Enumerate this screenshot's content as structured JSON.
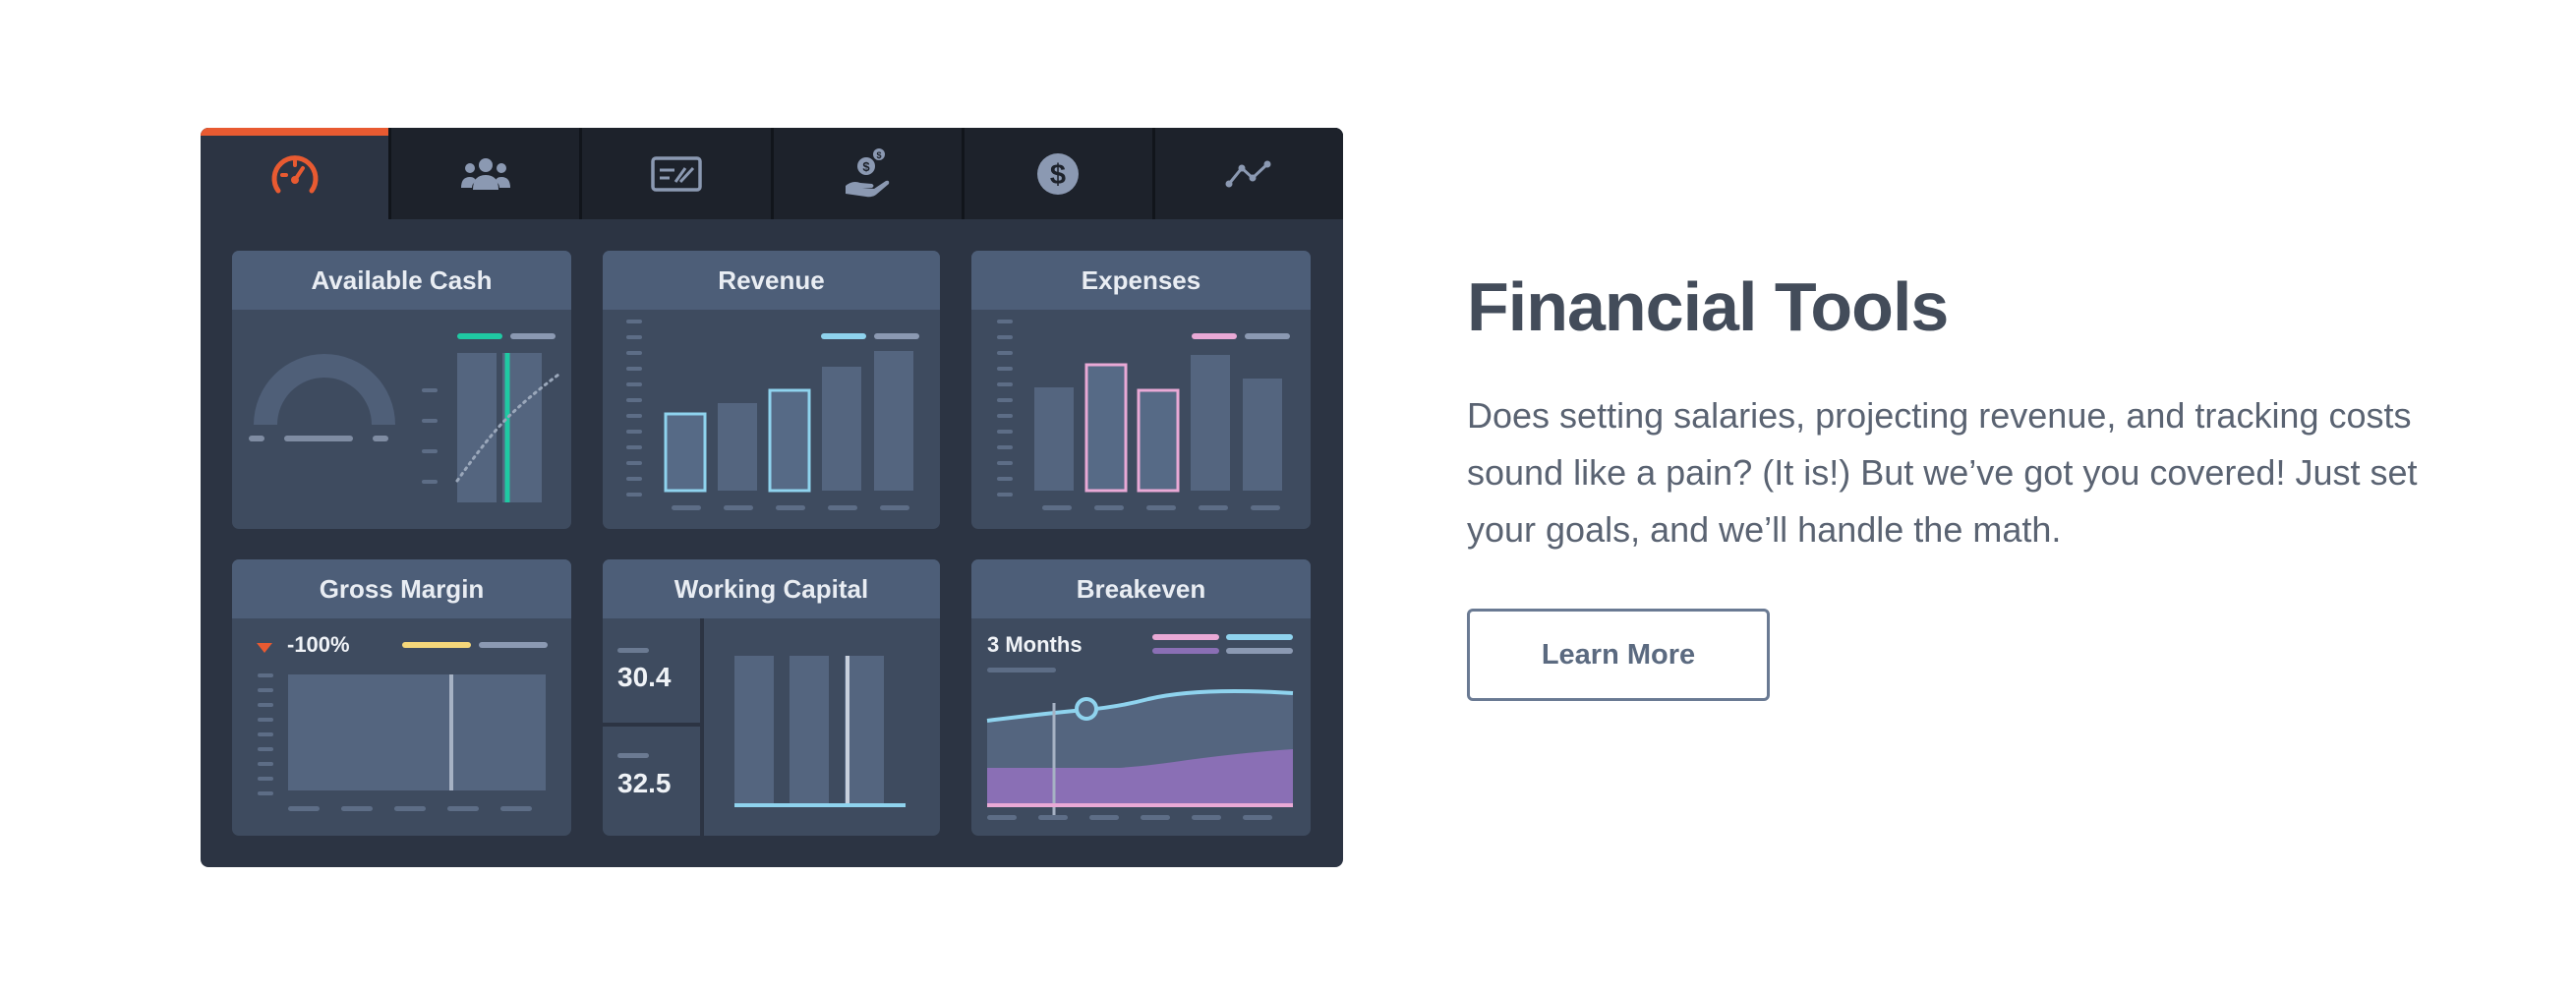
{
  "tabs": [
    {
      "icon": "speedometer-icon",
      "active": true
    },
    {
      "icon": "users-icon",
      "active": false
    },
    {
      "icon": "credit-card-icon",
      "active": false
    },
    {
      "icon": "hand-money-icon",
      "active": false
    },
    {
      "icon": "dollar-circle-icon",
      "active": false
    },
    {
      "icon": "line-chart-icon",
      "active": false
    }
  ],
  "colors": {
    "accent": "#e85a31",
    "teal": "#1fc9a3",
    "blue": "#8fd3ee",
    "pink": "#e9a9d6",
    "yellow": "#f5d77a",
    "purple": "#8a6fb5"
  },
  "panels": {
    "available_cash": {
      "title": "Available Cash"
    },
    "revenue": {
      "title": "Revenue",
      "bars_relative": [
        0.55,
        0.63,
        0.72,
        0.89,
        1.0
      ],
      "highlighted": [
        0,
        2
      ]
    },
    "expenses": {
      "title": "Expenses",
      "bars_relative": [
        0.74,
        0.9,
        0.72,
        0.97,
        0.8
      ],
      "highlighted": [
        1,
        2
      ]
    },
    "gross_margin": {
      "title": "Gross Margin",
      "value": "-100%"
    },
    "working_capital": {
      "title": "Working Capital",
      "value_1": "30.4",
      "value_2": "32.5"
    },
    "breakeven": {
      "title": "Breakeven",
      "value": "3 Months"
    }
  },
  "content": {
    "title": "Financial Tools",
    "description": "Does setting salaries, projecting revenue, and tracking costs sound like a pain? (It is!) But we’ve got you covered! Just set your goals, and we’ll handle the math.",
    "button_label": "Learn More"
  }
}
